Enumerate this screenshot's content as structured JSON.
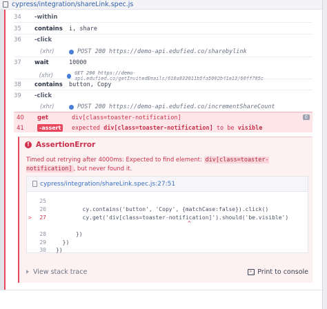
{
  "header": {
    "path": "cypress/integration/shareLink.spec.js"
  },
  "commands": [
    {
      "num": "34",
      "name": "-within",
      "msg": ""
    },
    {
      "num": "35",
      "name": "contains",
      "msg": "i, share"
    },
    {
      "num": "36",
      "name": "-click",
      "msg": ""
    },
    {
      "num": "",
      "name": "(xhr)",
      "msg": "POST 200 https://demo-api.edufied.co/sharebylink"
    },
    {
      "num": "37",
      "name": "wait",
      "msg": "10000"
    },
    {
      "num": "",
      "name": "(xhr)",
      "msg": "GET 200 https://demo-api.edufied.co/getInvitedEmails/610a833011b5fa5002b41e13/60ff785c"
    },
    {
      "num": "38",
      "name": "contains",
      "msg": "button, Copy"
    },
    {
      "num": "39",
      "name": "-click",
      "msg": ""
    },
    {
      "num": "",
      "name": "(xhr)",
      "msg": "POST 200 https://demo-api.edufied.co/incrementShareCount"
    }
  ],
  "failed": {
    "row1": {
      "num": "40",
      "name": "get",
      "msg": "div[class=toaster-notification]",
      "badge": "0"
    },
    "row2": {
      "num": "41",
      "tag": "-assert",
      "pre": "expected",
      "hl": "div[class=toaster-notification]",
      "mid": "to be",
      "end": "visible"
    }
  },
  "error": {
    "title": "AssertionError",
    "msg_pre": "Timed out retrying after 4000ms: Expected to find element:",
    "msg_code": "div[class=toaster-notification]",
    "msg_post": ", but never found it.",
    "frame_link": "cypress/integration/shareLink.spec.js:27:51",
    "code": [
      {
        "ln": "25",
        "src": "",
        "marker": ""
      },
      {
        "ln": "26",
        "src": "        cy.contains('button', 'Copy', {matchCase:false}).click()",
        "marker": ""
      },
      {
        "ln": "27",
        "src": "        cy.get('div[class=toaster-notification]').should('be.visible')",
        "marker": ">"
      },
      {
        "ln": "",
        "src": "",
        "marker": ""
      },
      {
        "ln": "28",
        "src": "      })",
        "marker": ""
      },
      {
        "ln": "29",
        "src": "  })",
        "marker": ""
      },
      {
        "ln": "30",
        "src": "})",
        "marker": ""
      }
    ],
    "caret": "^",
    "stack_label": "View stack trace",
    "print_label": "Print to console",
    "term_glyph": ">_"
  }
}
